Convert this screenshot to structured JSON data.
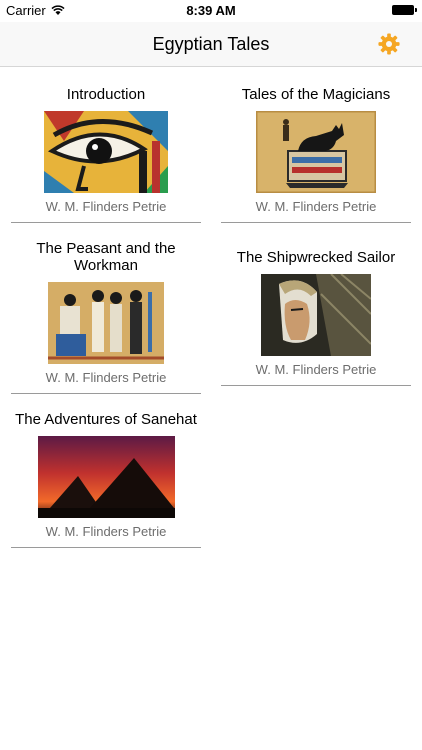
{
  "status": {
    "carrier": "Carrier",
    "time": "8:39 AM"
  },
  "nav": {
    "title": "Egyptian Tales",
    "settings_icon": "gear-icon",
    "accent": "#f5a623"
  },
  "books": [
    {
      "title": "Introduction",
      "author": "W. M. Flinders Petrie",
      "image": "eye-of-horus-art"
    },
    {
      "title": "Tales of the Magicians",
      "author": "W. M. Flinders Petrie",
      "image": "anubis-papyrus"
    },
    {
      "title": "The Peasant and the Workman",
      "author": "W. M. Flinders Petrie",
      "image": "egyptian-figures-papyrus"
    },
    {
      "title": "The Shipwrecked Sailor",
      "author": "W. M. Flinders Petrie",
      "image": "pharaoh-profile"
    },
    {
      "title": "The Adventures of Sanehat",
      "author": "W. M. Flinders Petrie",
      "image": "pyramids-sunset"
    }
  ]
}
